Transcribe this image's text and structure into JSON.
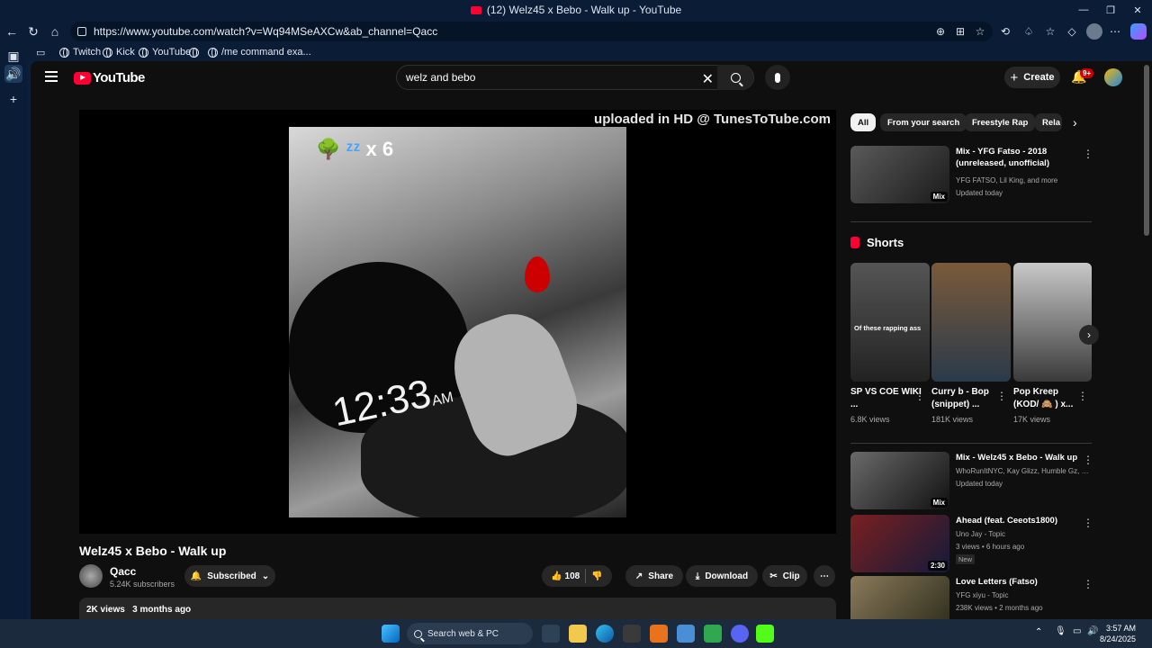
{
  "window": {
    "title": "(12) Welz45 x Bebo - Walk up - YouTube"
  },
  "browser": {
    "url": "https://www.youtube.com/watch?v=Wq94MSeAXCw&ab_channel=Qacc",
    "favorites": [
      "Twitch",
      "Kick",
      "YouTube",
      "",
      "/me command exa..."
    ]
  },
  "youtube": {
    "logo_text": "YouTube",
    "search_value": "welz and bebo",
    "create_label": "Create",
    "notif_count": "9+",
    "player": {
      "watermark": "uploaded in HD @ TunesToTube.com",
      "time": "12:33",
      "ampm": "AM",
      "stickers": "x 6"
    },
    "video": {
      "title": "Welz45 x Bebo - Walk up",
      "channel": "Qacc",
      "subscribers": "5.24K subscribers",
      "subscribed_label": "Subscribed",
      "likes": "108",
      "share_label": "Share",
      "download_label": "Download",
      "clip_label": "Clip",
      "views": "2K views",
      "age": "3 months ago"
    },
    "chips": [
      "All",
      "From your search",
      "Freestyle Rap",
      "Rela"
    ],
    "related_top": {
      "title": "Mix - YFG Fatso - 2018 (unreleased, unofficial)",
      "meta": "YFG FATSO, Lil King, and more",
      "updated": "Updated today",
      "badge": "Mix"
    },
    "shorts_heading": "Shorts",
    "shorts": [
      {
        "title": "SP VS COE WIKI ...",
        "views": "6.8K views",
        "caption": "Of these rapping ass"
      },
      {
        "title": "Curry b - Bop (snippet) ...",
        "views": "181K views",
        "caption": ""
      },
      {
        "title": "Pop Kreep (KOD/ 🙈 ) x...",
        "views": "17K views",
        "caption": ""
      }
    ],
    "related": [
      {
        "title": "Mix - Welz45 x Bebo - Walk up",
        "meta1": "WhoRunItNYC, Kay Glizz, Humble Gz, an...",
        "meta2": "Updated today",
        "badge": "Mix"
      },
      {
        "title": "Ahead (feat. Ceeots1800)",
        "meta1": "Uno Jay - Topic",
        "meta2": "3 views • 6 hours ago",
        "badge": "2:30",
        "new": "New"
      },
      {
        "title": "Love Letters (Fatso)",
        "meta1": "YFG xiyu - Topic",
        "meta2": "238K views • 2 months ago",
        "badge": ""
      }
    ]
  },
  "taskbar": {
    "search_placeholder": "Search web & PC",
    "time": "3:57 AM",
    "date": "8/24/2025"
  },
  "colors": {
    "youtube_red": "#ff0033",
    "page_bg": "#0f0f0f",
    "chrome_bg": "#0a1c36"
  }
}
